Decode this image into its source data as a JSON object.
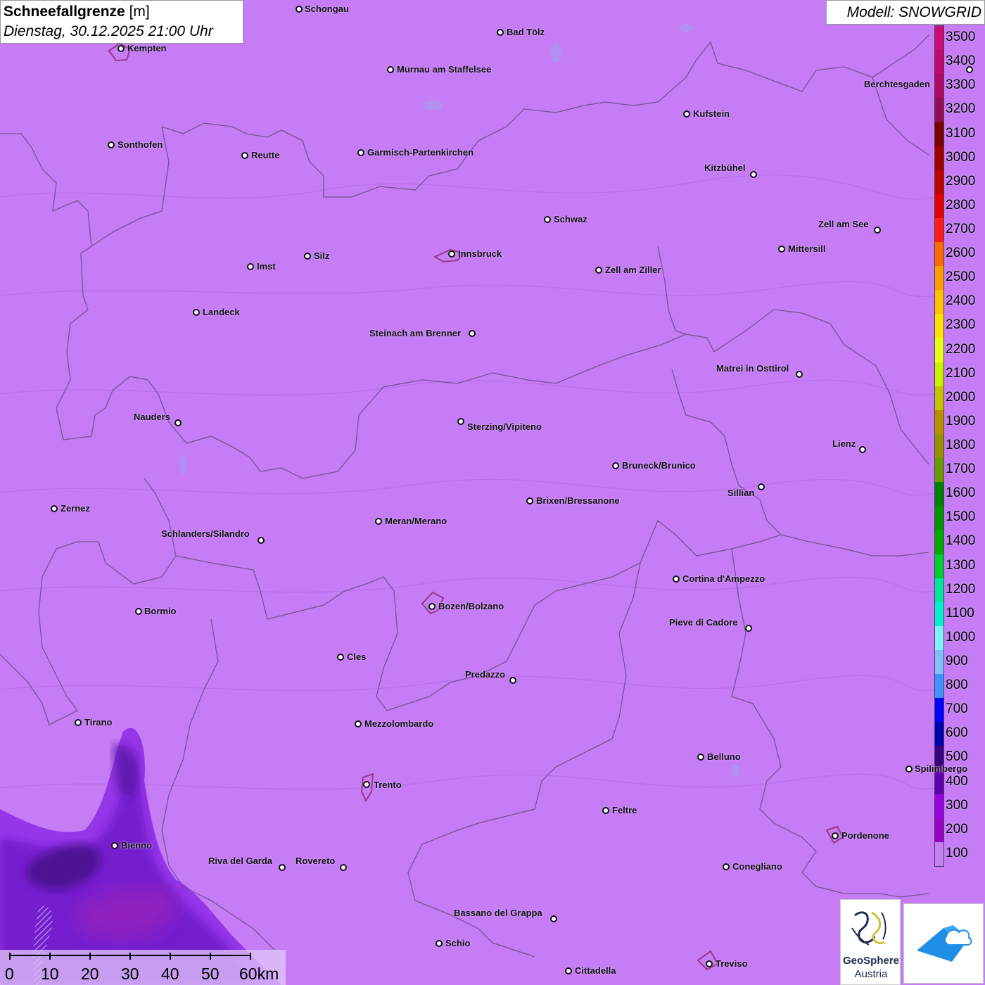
{
  "title": {
    "parameter": "Schneefallgrenze",
    "unit": " [m]",
    "datetime": "Dienstag, 30.12.2025 21:00 Uhr"
  },
  "model_label": "Modell: SNOWGRID",
  "legend": {
    "levels": [
      "3500",
      "3400",
      "3300",
      "3200",
      "3100",
      "3000",
      "2900",
      "2800",
      "2700",
      "2600",
      "2500",
      "2400",
      "2300",
      "2200",
      "2100",
      "2000",
      "1900",
      "1800",
      "1700",
      "1600",
      "1500",
      "1400",
      "1300",
      "1200",
      "1100",
      "1000",
      "900",
      "800",
      "700",
      "600",
      "500",
      "400",
      "300",
      "200",
      "100"
    ],
    "colors": [
      "#cc0a7a",
      "#c0086f",
      "#ac0864",
      "#960a59",
      "#7a0000",
      "#a00000",
      "#c00000",
      "#e00000",
      "#ff1a1a",
      "#ff6a00",
      "#ff9a00",
      "#ffc000",
      "#ffe000",
      "#e8ff1a",
      "#c8f000",
      "#c8c000",
      "#b89000",
      "#989000",
      "#6a9a00",
      "#008000",
      "#009400",
      "#00aa00",
      "#00cc33",
      "#00e6a0",
      "#00f0d0",
      "#80f0ff",
      "#80c0ff",
      "#4090ff",
      "#0000ff",
      "#0000b0",
      "#3a0080",
      "#6000b0",
      "#9a00e6",
      "#9a00c8",
      "#c77ef6"
    ]
  },
  "cities": [
    {
      "name": "Schongau"
    },
    {
      "name": "Bad Tölz"
    },
    {
      "name": "Kempten"
    },
    {
      "name": "Murnau am Staffelsee"
    },
    {
      "name": "Kufstein"
    },
    {
      "name": "Berchtesgaden"
    },
    {
      "name": "Sonthofen"
    },
    {
      "name": "Reutte"
    },
    {
      "name": "Garmisch-Partenkirchen"
    },
    {
      "name": "Kitzbühel"
    },
    {
      "name": "Schwaz"
    },
    {
      "name": "Zell am See"
    },
    {
      "name": "Innsbruck"
    },
    {
      "name": "Mittersill"
    },
    {
      "name": "Imst"
    },
    {
      "name": "Silz"
    },
    {
      "name": "Zell am Ziller"
    },
    {
      "name": "Landeck"
    },
    {
      "name": "Steinach am Brenner"
    },
    {
      "name": "Matrei in Osttirol"
    },
    {
      "name": "Nauders"
    },
    {
      "name": "Sterzing/Vipiteno"
    },
    {
      "name": "Lienz"
    },
    {
      "name": "Bruneck/Brunico"
    },
    {
      "name": "Sillian"
    },
    {
      "name": "Zernez"
    },
    {
      "name": "Brixen/Bressanone"
    },
    {
      "name": "Meran/Merano"
    },
    {
      "name": "Schlanders/Silandro"
    },
    {
      "name": "Cortina d'Ampezzo"
    },
    {
      "name": "Bozen/Bolzano"
    },
    {
      "name": "Bormio"
    },
    {
      "name": "Pieve di Cadore"
    },
    {
      "name": "Cles"
    },
    {
      "name": "Predazzo"
    },
    {
      "name": "Tirano"
    },
    {
      "name": "Mezzolombardo"
    },
    {
      "name": "Belluno"
    },
    {
      "name": "Spilimbergo"
    },
    {
      "name": "Trento"
    },
    {
      "name": "Feltre"
    },
    {
      "name": "Pordenone"
    },
    {
      "name": "Bienno"
    },
    {
      "name": "Riva del Garda"
    },
    {
      "name": "Rovereto"
    },
    {
      "name": "Conegliano"
    },
    {
      "name": "Bassano del Grappa"
    },
    {
      "name": "Schio"
    },
    {
      "name": "Treviso"
    },
    {
      "name": "Cittadella"
    }
  ],
  "scale_bar": {
    "labels": [
      "0",
      "10",
      "20",
      "30",
      "40",
      "50",
      "60km"
    ]
  },
  "logos": {
    "geosphere_name": "GeoSphere",
    "geosphere_sub": "Austria"
  }
}
